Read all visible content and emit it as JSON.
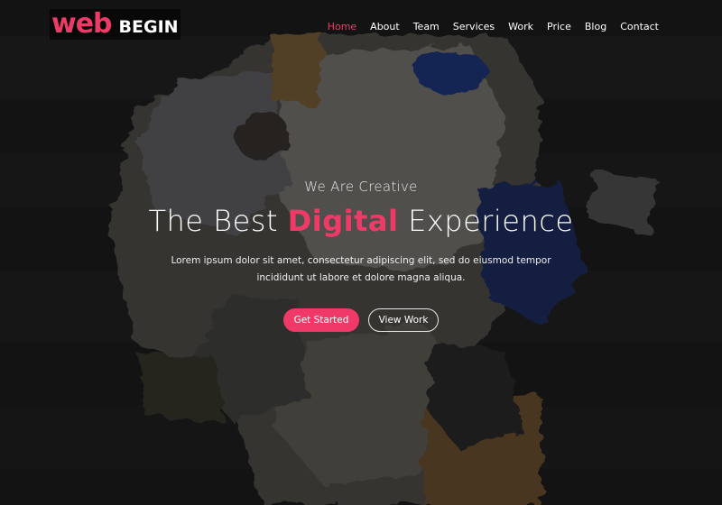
{
  "logo": {
    "primary": "web",
    "secondary": "BEGIN"
  },
  "nav": {
    "items": [
      {
        "label": "Home",
        "active": true
      },
      {
        "label": "About",
        "active": false
      },
      {
        "label": "Team",
        "active": false
      },
      {
        "label": "Services",
        "active": false
      },
      {
        "label": "Work",
        "active": false
      },
      {
        "label": "Price",
        "active": false
      },
      {
        "label": "Blog",
        "active": false
      },
      {
        "label": "Contact",
        "active": false
      }
    ]
  },
  "hero": {
    "tagline": "We Are Creative",
    "headline_pre": "The Best ",
    "headline_accent": "Digital",
    "headline_post": " Experience",
    "description": "Lorem ipsum dolor sit amet, consectetur adipiscing elit, sed do eiusmod tempor incididunt ut labore et dolore magna aliqua.",
    "primary_button": "Get Started",
    "secondary_button": "View Work"
  },
  "colors": {
    "accent": "#ef3a68",
    "background": "#141414",
    "text": "#ffffff"
  }
}
